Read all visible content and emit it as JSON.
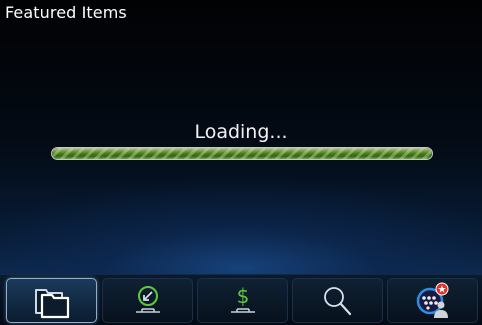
{
  "header": {
    "title": "Featured Items"
  },
  "loading": {
    "label": "Loading...",
    "progress": 1.0
  },
  "bottom_bar": {
    "selected_index": 0,
    "buttons": [
      {
        "icon": "folder-icon"
      },
      {
        "icon": "download-icon"
      },
      {
        "icon": "dollar-icon"
      },
      {
        "icon": "search-icon"
      },
      {
        "icon": "blackberry-profile-icon"
      }
    ]
  },
  "colors": {
    "progress_green": "#3c7a14",
    "accent_blue": "#2a8fe8",
    "icon_green": "#5ecb3e",
    "badge_red": "#e0322a"
  }
}
